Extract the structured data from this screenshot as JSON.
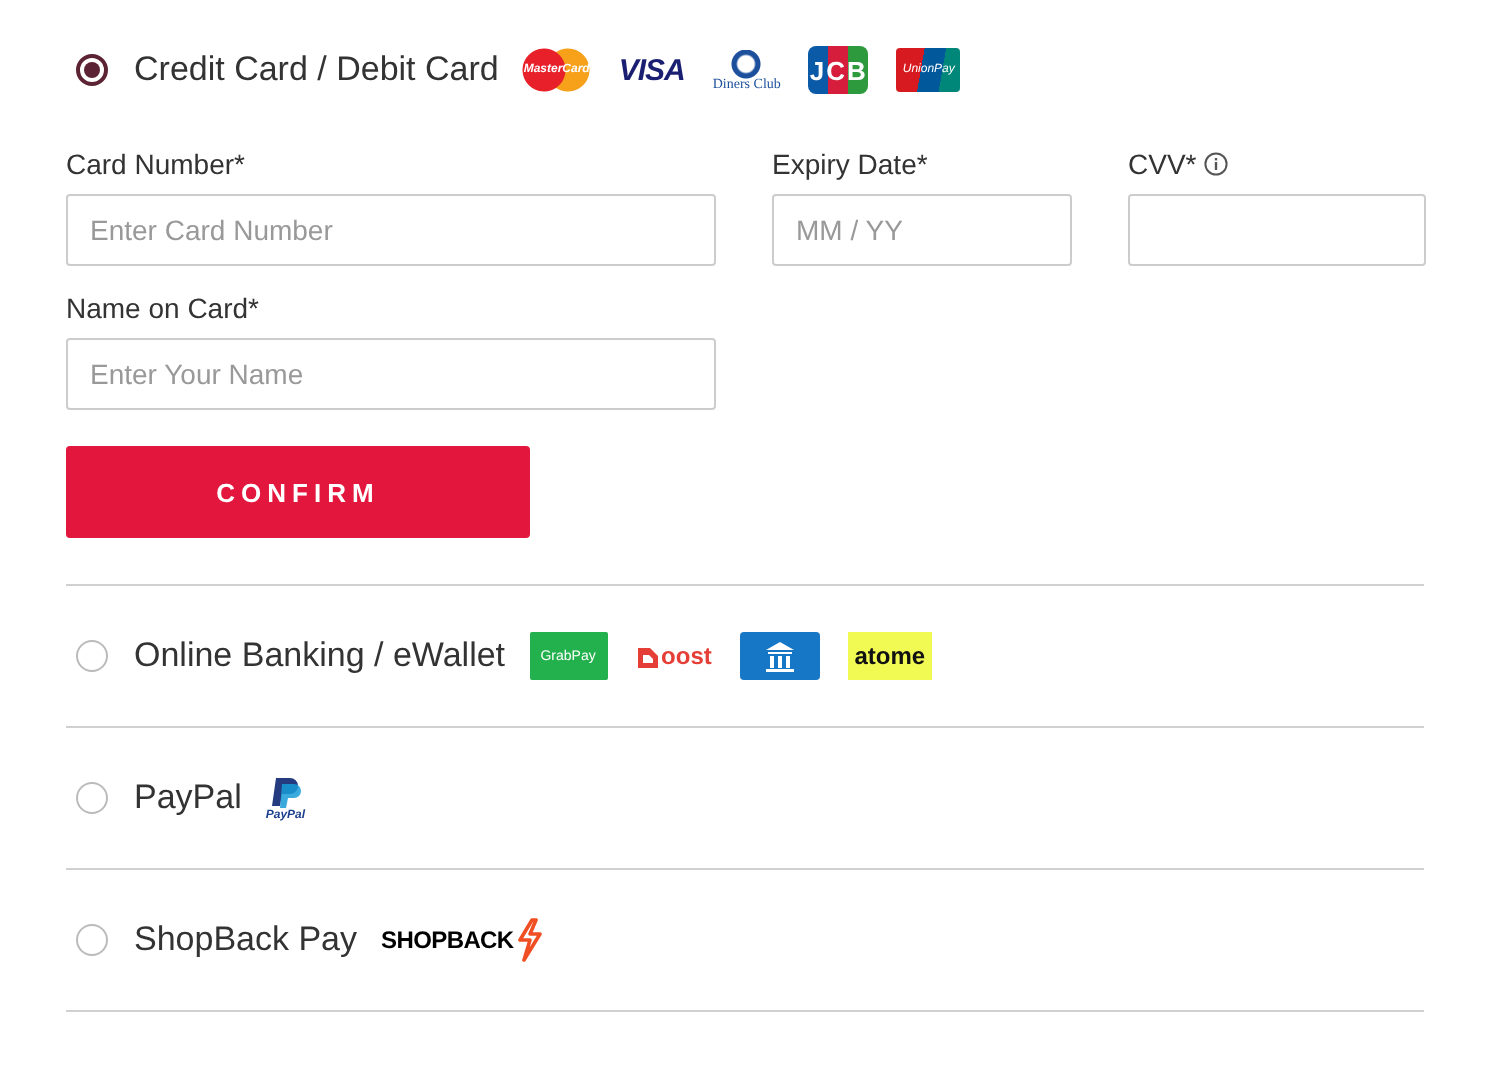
{
  "payment_methods": [
    {
      "label": "Credit Card / Debit Card",
      "selected": true,
      "logos": [
        {
          "kind": "mastercard",
          "text": "MasterCard"
        },
        {
          "kind": "visa",
          "text": "VISA"
        },
        {
          "kind": "diners",
          "text": "Diners Club"
        },
        {
          "kind": "jcb",
          "text": "JCB"
        },
        {
          "kind": "unionpay",
          "text": "UnionPay"
        }
      ],
      "form": {
        "fields": [
          {
            "label": "Card Number*",
            "placeholder": "Enter Card Number",
            "info": false
          },
          {
            "label": "Expiry Date*",
            "placeholder": "MM / YY",
            "info": false
          },
          {
            "label": "CVV*",
            "info": true
          },
          {
            "label": "Name on Card*",
            "placeholder": "Enter Your Name",
            "info": false
          }
        ],
        "button": "CONFIRM"
      }
    },
    {
      "label": "Online Banking / eWallet",
      "selected": false,
      "logos": [
        {
          "kind": "grabpay",
          "text": "GrabPay"
        },
        {
          "kind": "boost",
          "text": "oost"
        },
        {
          "kind": "bank"
        },
        {
          "kind": "atome",
          "text": "atome"
        }
      ]
    },
    {
      "label": "PayPal",
      "selected": false,
      "logos": [
        {
          "kind": "paypal",
          "text": "PayPal"
        }
      ]
    },
    {
      "label": "ShopBack Pay",
      "selected": false,
      "logos": [
        {
          "kind": "shopback",
          "text": "SHOPBACK"
        }
      ]
    }
  ]
}
